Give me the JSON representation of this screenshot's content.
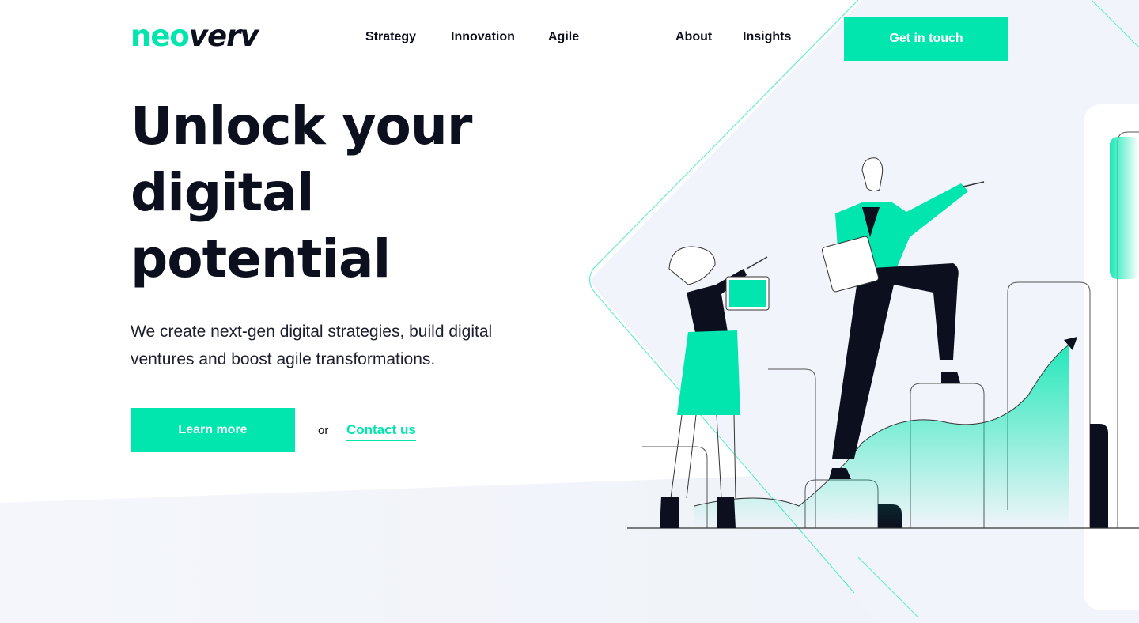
{
  "brand": {
    "logo_part1": "neo",
    "logo_part2": "verv",
    "accent_color": "#00e6ae",
    "text_color": "#0c0f1e"
  },
  "nav": {
    "items": [
      {
        "label": "Strategy"
      },
      {
        "label": "Innovation"
      },
      {
        "label": "Agile"
      },
      {
        "label": "About"
      },
      {
        "label": "Insights"
      }
    ],
    "cta_label": "Get in touch"
  },
  "hero": {
    "headline_lines": [
      "Unlock your",
      "digital",
      "potential"
    ],
    "lead_line1": "We create next-gen digital strategies, build digital",
    "lead_line2": "ventures and boost agile transformations.",
    "primary_button": "Learn more",
    "or_text": "or",
    "secondary_link": "Contact us"
  },
  "illustration": {
    "icon": "business-growth-illustration"
  }
}
